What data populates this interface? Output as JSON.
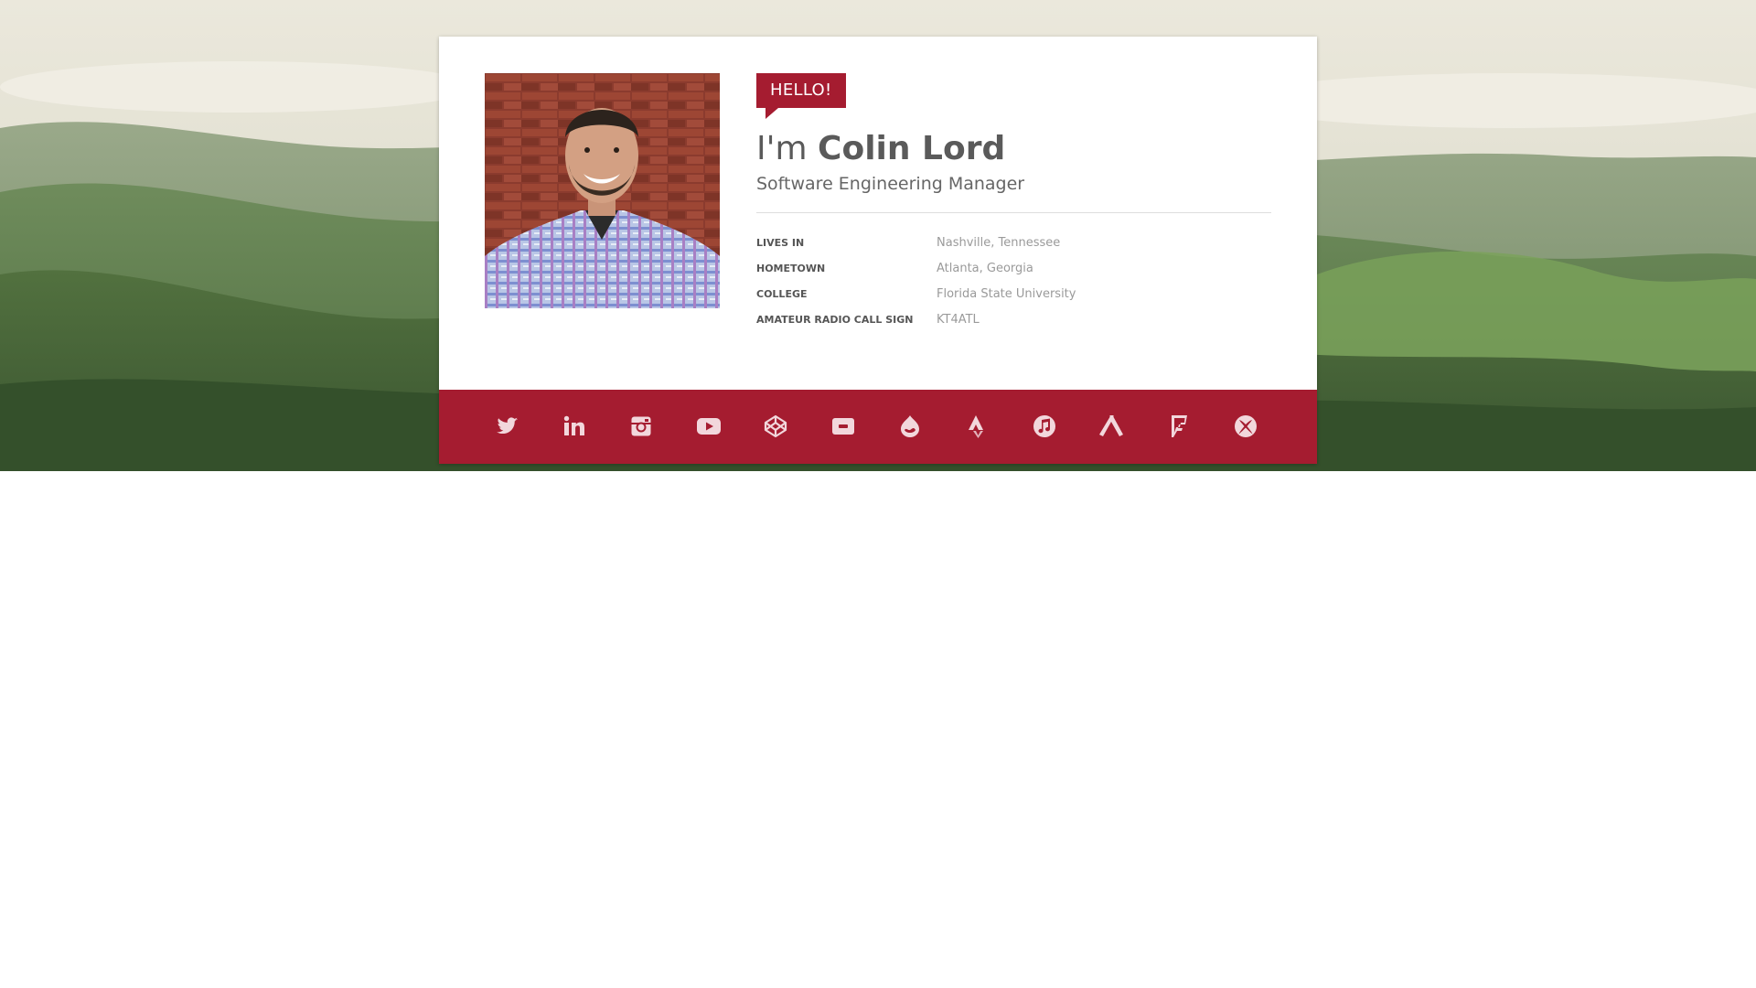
{
  "profile": {
    "badge": "HELLO!",
    "greeting": "I'm",
    "name": "Colin Lord",
    "job_title": "Software Engineering Manager",
    "facts": [
      {
        "label": "LIVES IN",
        "value": "Nashville, Tennessee"
      },
      {
        "label": "HOMETOWN",
        "value": "Atlanta, Georgia"
      },
      {
        "label": "COLLEGE",
        "value": "Florida State University"
      },
      {
        "label": "AMATEUR RADIO CALL SIGN",
        "value": "KT4ATL"
      }
    ]
  },
  "social_links": [
    {
      "icon": "twitter-icon"
    },
    {
      "icon": "linkedin-icon"
    },
    {
      "icon": "instagram-icon"
    },
    {
      "icon": "youtube-icon"
    },
    {
      "icon": "codepen-icon"
    },
    {
      "icon": "youtube-gaming-icon"
    },
    {
      "icon": "drupal-icon"
    },
    {
      "icon": "strava-icon"
    },
    {
      "icon": "itunes-icon"
    },
    {
      "icon": "untappd-icon"
    },
    {
      "icon": "foursquare-icon"
    },
    {
      "icon": "xbox-icon"
    }
  ],
  "colors": {
    "accent": "#a51c30",
    "card_background": "#ffffff",
    "icon_color": "#f2d7dc",
    "label_text": "#555555",
    "value_text": "#9a9a9a"
  }
}
